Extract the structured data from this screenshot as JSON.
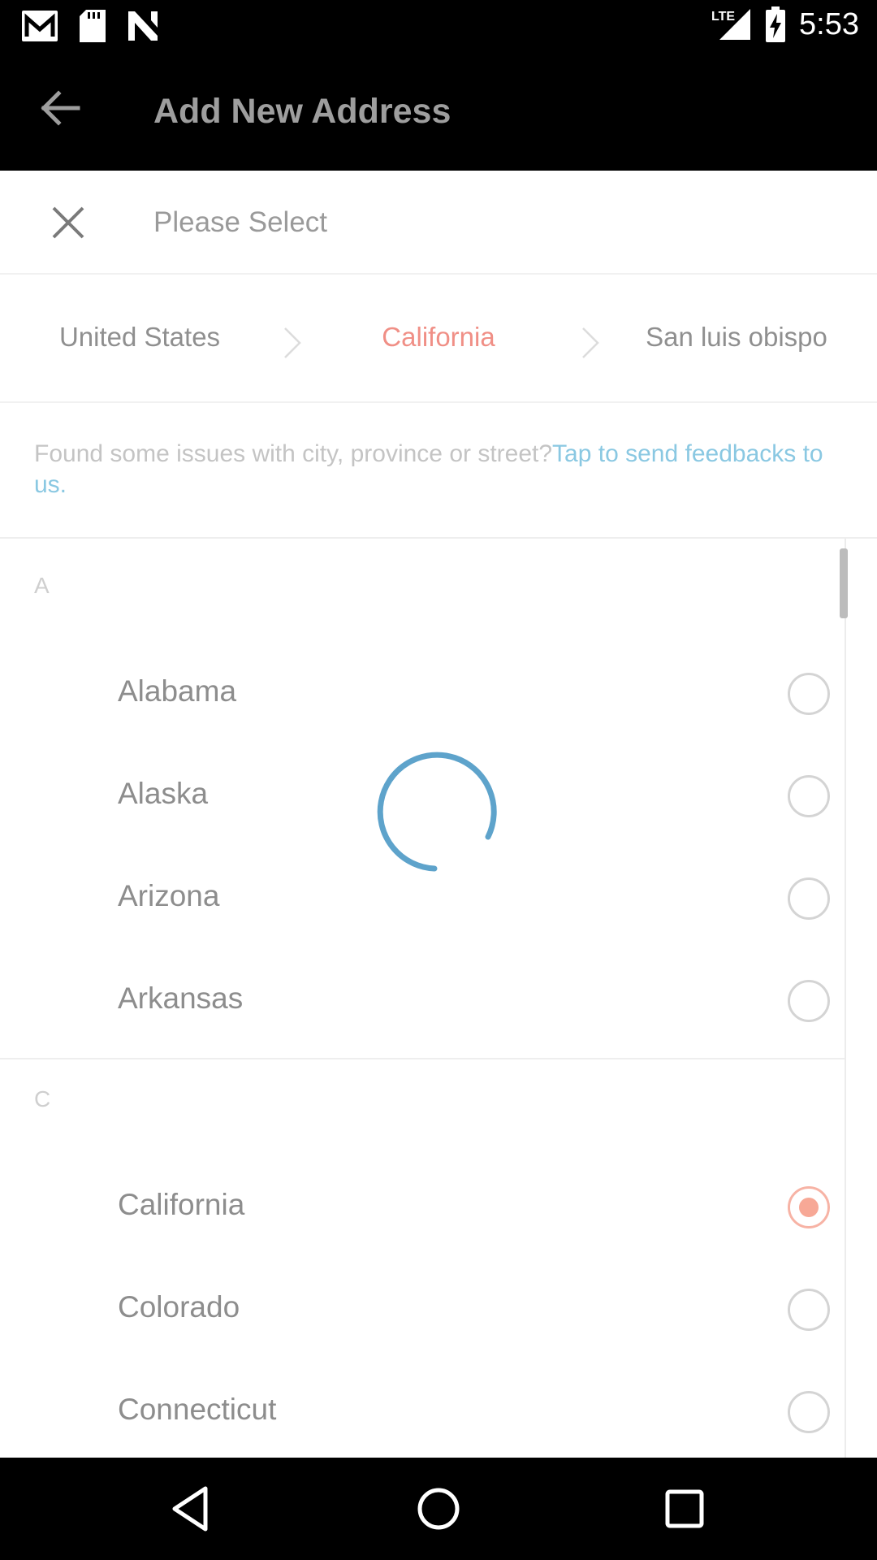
{
  "status_bar": {
    "time": "5:53",
    "network": "LTE",
    "icons": [
      "gmail-icon",
      "sd-card-icon",
      "n-icon",
      "signal-icon",
      "battery-charging-icon"
    ]
  },
  "app_bar": {
    "title": "Add New Address",
    "back_icon": "arrow-left-icon"
  },
  "sheet": {
    "title": "Please Select",
    "close_icon": "close-icon"
  },
  "breadcrumb": {
    "items": [
      "United States",
      "California",
      "San luis obispo"
    ],
    "active_index": 1,
    "active_color": "#f08f86"
  },
  "feedback": {
    "text": "Found some issues with city, province or street?",
    "link": "Tap to send feedbacks to us."
  },
  "list": {
    "sections": [
      {
        "letter": "A",
        "items": [
          {
            "label": "Alabama",
            "selected": false
          },
          {
            "label": "Alaska",
            "selected": false
          },
          {
            "label": "Arizona",
            "selected": false
          },
          {
            "label": "Arkansas",
            "selected": false
          }
        ]
      },
      {
        "letter": "C",
        "items": [
          {
            "label": "California",
            "selected": true
          },
          {
            "label": "Colorado",
            "selected": false
          },
          {
            "label": "Connecticut",
            "selected": false
          }
        ]
      }
    ],
    "selected_color": "#f7a896"
  },
  "loading": {
    "visible": true,
    "color": "#5ea3cb"
  },
  "nav_bar": {
    "icons": [
      "nav-back-icon",
      "nav-home-icon",
      "nav-recents-icon"
    ]
  }
}
